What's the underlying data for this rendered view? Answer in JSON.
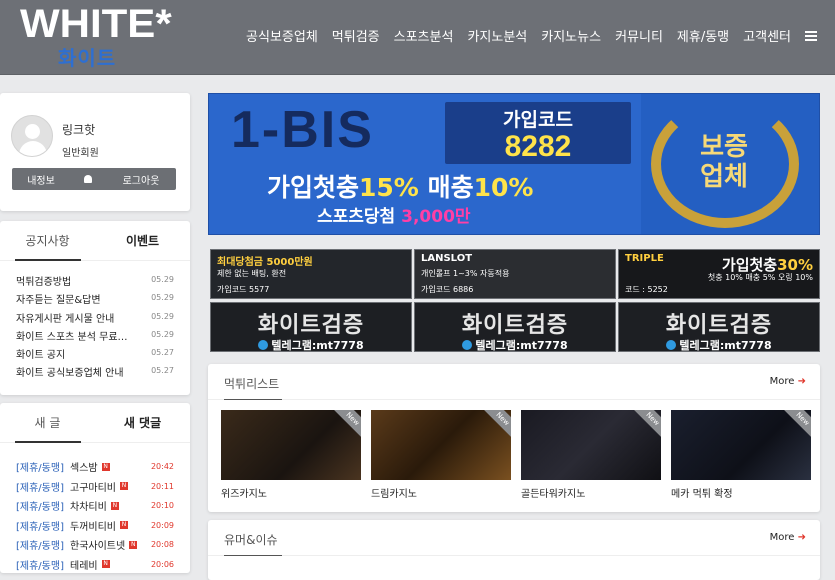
{
  "header": {
    "logo_top": "WHITE",
    "logo_star": "*",
    "logo_bottom": "화이트",
    "nav": [
      "공식보증업체",
      "먹튀검증",
      "스포츠분석",
      "카지노분석",
      "카지노뉴스",
      "커뮤니티",
      "제휴/동맹",
      "고객센터"
    ]
  },
  "profile": {
    "name": "링크핫",
    "role": "일반회원",
    "buttons": [
      "내정보",
      "로그아웃"
    ]
  },
  "notice": {
    "tabs": [
      "공지사항",
      "이벤트"
    ],
    "items": [
      {
        "title": "먹튀검증방법",
        "date": "05.29"
      },
      {
        "title": "자주듣는 질문&답변",
        "date": "05.29"
      },
      {
        "title": "자유게시판 게시물 안내",
        "date": "05.29"
      },
      {
        "title": "화이트 스포츠 분석 무료제...",
        "date": "05.29"
      },
      {
        "title": "화이트 공지",
        "date": "05.27"
      },
      {
        "title": "화이트 공식보증업체 안내",
        "date": "05.27"
      }
    ]
  },
  "posts": {
    "tabs": [
      "새 글",
      "새 댓글"
    ],
    "items": [
      {
        "cat": "[제휴/동맹]",
        "title": "섹스밤",
        "time": "20:42"
      },
      {
        "cat": "[제휴/동맹]",
        "title": "고구마티비",
        "time": "20:11"
      },
      {
        "cat": "[제휴/동맹]",
        "title": "차차티비",
        "time": "20:10"
      },
      {
        "cat": "[제휴/동맹]",
        "title": "두꺼비티비",
        "time": "20:09"
      },
      {
        "cat": "[제휴/동맹]",
        "title": "한국사이트넷",
        "time": "20:08"
      },
      {
        "cat": "[제휴/동맹]",
        "title": "테레비",
        "time": "20:06"
      }
    ]
  },
  "banner": {
    "brand": "1-BIS",
    "code_label": "가입코드",
    "code": "8282",
    "line2a": "가입첫충",
    "line2b": "15%",
    "line2c": "매충",
    "line2d": "10%",
    "line3a": "스포츠당첨",
    "line3b": "3,000만",
    "seal": "보증업체"
  },
  "minibanners": [
    {
      "title": "최대당첨금 5000만원",
      "sub": "제한 없는 배팅, 환전",
      "code": "가입코드 5577",
      "right_a": "",
      "right_b": ""
    },
    {
      "title": "LANSLOT",
      "sub": "개인롤프 1~3% 자동적용",
      "code": "가입코드 6886",
      "right_a": "",
      "right_b": ""
    },
    {
      "title": "TRIPLE",
      "sub": "첫충 10% 매충 5% 오링 10%",
      "code": "코드 : 5252",
      "right_a": "가입첫충",
      "right_b": "30%"
    }
  ],
  "verify_banner": {
    "title": "화이트검증",
    "telegram": "텔레그램:mt7778"
  },
  "muktwi": {
    "title": "먹튀리스트",
    "more": "More",
    "corner": "New",
    "items": [
      "위즈카지노",
      "드림카지노",
      "골든타워카지노",
      "메카 먹튀 확정"
    ]
  },
  "humor": {
    "title": "유머&이슈",
    "more": "More"
  },
  "colors": {
    "header_bg": "#6d7076",
    "accent_blue": "#2c62b8",
    "alert_red": "#e0382d",
    "banner_blue": "#2a6bd0",
    "gold": "#ffe34a"
  }
}
